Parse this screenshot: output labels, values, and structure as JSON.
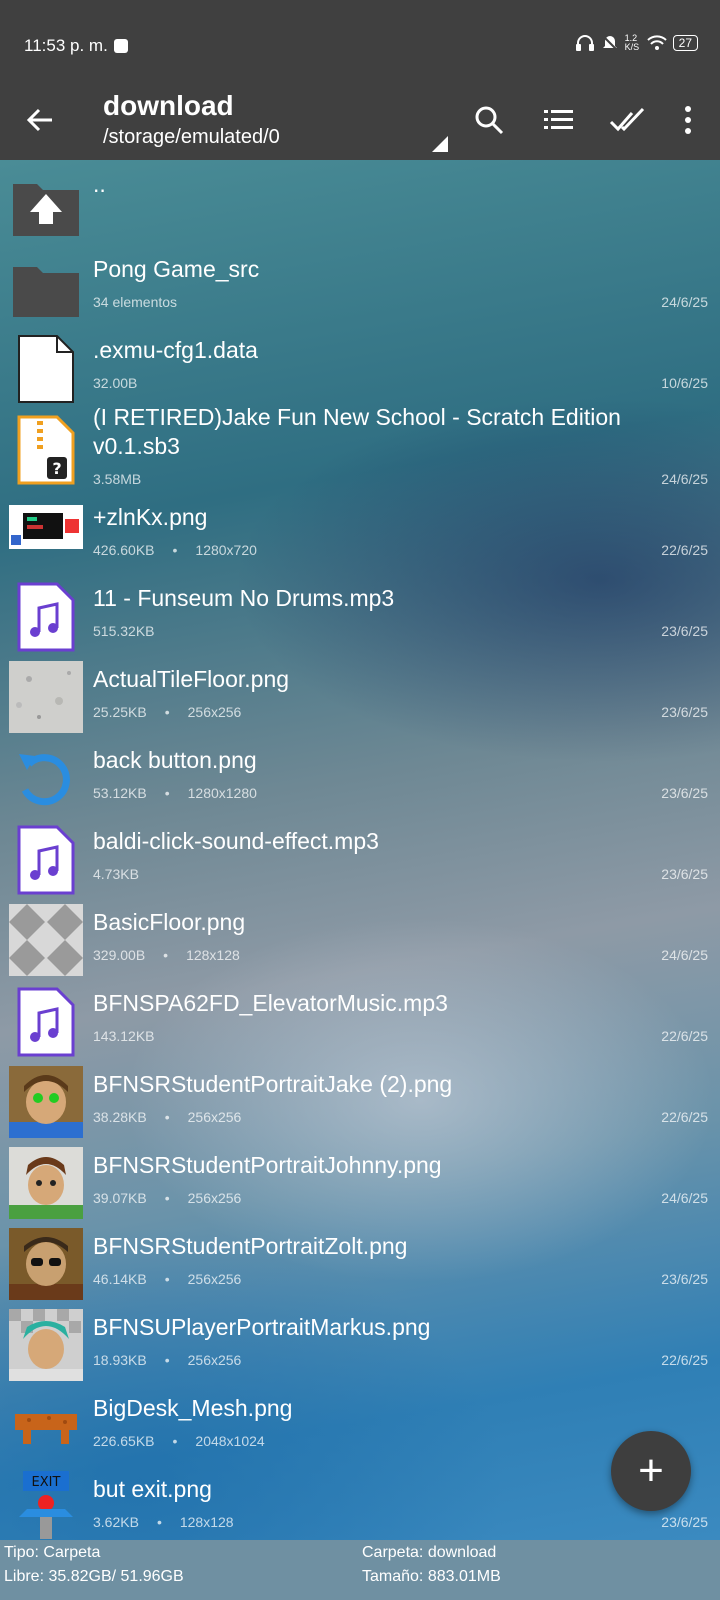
{
  "status_bar": {
    "time": "11:53 p. m.",
    "net_speed": "1.2\nK/S",
    "battery": "27"
  },
  "toolbar": {
    "title": "download",
    "path": "/storage/emulated/0"
  },
  "files": [
    {
      "name": "..",
      "meta": "",
      "date": "",
      "icon": "folder-up-icon"
    },
    {
      "name": "Pong Game_src",
      "meta": "34 elementos",
      "date": "24/6/25",
      "icon": "folder-icon"
    },
    {
      "name": ".exmu-cfg1.data",
      "meta": "32.00B",
      "date": "10/6/25",
      "icon": "document-icon"
    },
    {
      "name": "(I RETIRED)Jake Fun New School - Scratch Edition v0.1.sb3",
      "meta": "3.58MB",
      "date": "24/6/25",
      "icon": "archive-unknown-icon"
    },
    {
      "name": "+zlnKx.png",
      "meta": "426.60KB",
      "res": "1280x720",
      "date": "22/6/25",
      "icon": "image-thumbnail"
    },
    {
      "name": "11 - Funseum No Drums.mp3",
      "meta": "515.32KB",
      "date": "23/6/25",
      "icon": "music-file-icon"
    },
    {
      "name": "ActualTileFloor.png",
      "meta": "25.25KB",
      "res": "256x256",
      "date": "23/6/25",
      "icon": "tile-thumbnail"
    },
    {
      "name": "back button.png",
      "meta": "53.12KB",
      "res": "1280x1280",
      "date": "23/6/25",
      "icon": "back-arrow-thumbnail"
    },
    {
      "name": "baldi-click-sound-effect.mp3",
      "meta": "4.73KB",
      "date": "23/6/25",
      "icon": "music-file-icon"
    },
    {
      "name": "BasicFloor.png",
      "meta": "329.00B",
      "res": "128x128",
      "date": "24/6/25",
      "icon": "checker-thumbnail"
    },
    {
      "name": "BFNSPA62FD_ElevatorMusic.mp3",
      "meta": "143.12KB",
      "date": "22/6/25",
      "icon": "music-file-icon"
    },
    {
      "name": "BFNSRStudentPortraitJake (2).png",
      "meta": "38.28KB",
      "res": "256x256",
      "date": "22/6/25",
      "icon": "portrait-thumbnail"
    },
    {
      "name": "BFNSRStudentPortraitJohnny.png",
      "meta": "39.07KB",
      "res": "256x256",
      "date": "24/6/25",
      "icon": "portrait-thumbnail"
    },
    {
      "name": "BFNSRStudentPortraitZolt.png",
      "meta": "46.14KB",
      "res": "256x256",
      "date": "23/6/25",
      "icon": "portrait-thumbnail"
    },
    {
      "name": "BFNSUPlayerPortraitMarkus.png",
      "meta": "18.93KB",
      "res": "256x256",
      "date": "22/6/25",
      "icon": "portrait-thumbnail"
    },
    {
      "name": "BigDesk_Mesh.png",
      "meta": "226.65KB",
      "res": "2048x1024",
      "date": "",
      "icon": "desk-thumbnail"
    },
    {
      "name": "but exit.png",
      "meta": "3.62KB",
      "res": "128x128",
      "date": "23/6/25",
      "icon": "exit-button-thumbnail"
    }
  ],
  "footer": {
    "type": "Tipo: Carpeta",
    "free": "Libre: 35.82GB/ 51.96GB",
    "folder": "Carpeta: download",
    "size": "Tamaño: 883.01MB"
  },
  "colors": {
    "bar": "#404040",
    "music_accent": "#6a3fd0",
    "archive_accent": "#f0a020"
  }
}
